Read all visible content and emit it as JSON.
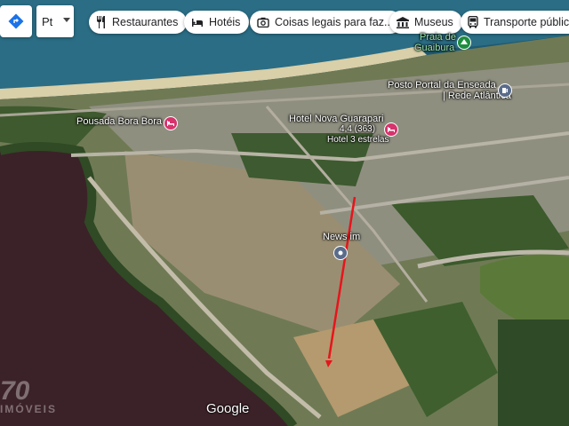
{
  "toolbar": {
    "language_label": "Pt",
    "chips": [
      {
        "label": "Restaurantes",
        "icon": "fork-knife-icon"
      },
      {
        "label": "Hotéis",
        "icon": "bed-icon"
      },
      {
        "label": "Coisas legais para faz...",
        "icon": "camera-icon"
      },
      {
        "label": "Museus",
        "icon": "museum-icon"
      },
      {
        "label": "Transporte público",
        "icon": "bus-icon"
      }
    ]
  },
  "places": {
    "praia": {
      "line1": "Praia de",
      "line2": "Guaibura"
    },
    "posto": {
      "line1": "Posto Portal da Enseada",
      "line2": "| Rede Atlântica"
    },
    "pousada": {
      "name": "Pousada Bora Bora"
    },
    "hotel": {
      "name": "Hotel Nova Guarapari",
      "rating": "4,4 (363)",
      "category": "Hotel 3 estrelas"
    },
    "news": {
      "name": "News im"
    }
  },
  "footer": {
    "google": "Google",
    "watermark": "70",
    "watermark_sub": "IMÓVEIS"
  },
  "colors": {
    "hotel_pin": "#d6336c",
    "park_pin": "#1e8e3e",
    "info_pin": "#5a6c8a",
    "arrow": "#e8141b"
  }
}
